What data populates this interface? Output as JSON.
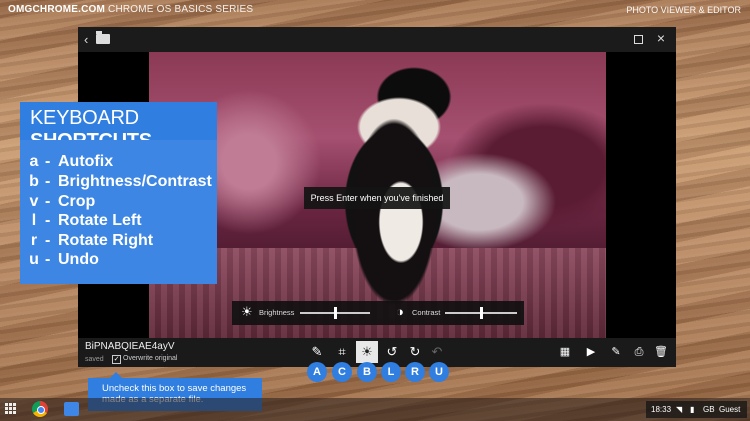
{
  "banner": {
    "brand": "OMGCHROME.COM",
    "series": "CHROME OS BASICS SERIES",
    "right_title": "PHOTO VIEWER & EDITOR"
  },
  "editor": {
    "enter_tooltip": "Press Enter when you've finished",
    "adjust": {
      "brightness_label": "Brightness",
      "contrast_label": "Contrast",
      "brightness_level": 0.5,
      "contrast_level": 0.5
    },
    "file": {
      "name": "BiPNABQIEAE4ayV",
      "status": "saved",
      "overwrite_label": "Overwrite original",
      "overwrite_checked": true
    },
    "tools": [
      {
        "icon": "autofix-icon",
        "glyph": "✎"
      },
      {
        "icon": "crop-icon",
        "glyph": "⌗"
      },
      {
        "icon": "brightness-icon",
        "glyph": "☀"
      },
      {
        "icon": "rotate-left-icon",
        "glyph": "↺"
      },
      {
        "icon": "rotate-right-icon",
        "glyph": "↻"
      },
      {
        "icon": "undo-icon",
        "glyph": "↶"
      }
    ],
    "right_tools": [
      {
        "icon": "mosaic-icon",
        "glyph": "▦"
      },
      {
        "icon": "slideshow-icon",
        "glyph": "▶"
      },
      {
        "icon": "edit-icon",
        "glyph": "✎"
      },
      {
        "icon": "print-icon",
        "glyph": "⎙"
      },
      {
        "icon": "delete-icon",
        "glyph": "🗑"
      }
    ]
  },
  "shortcuts": {
    "title_light": "KEYBOARD",
    "title_bold": "SHORTCUTS",
    "dash": "-",
    "items": [
      {
        "key": "a",
        "action": "Autofix"
      },
      {
        "key": "b",
        "action": "Brightness/Contrast"
      },
      {
        "key": "v",
        "action": "Crop"
      },
      {
        "key": "l",
        "action": "Rotate Left"
      },
      {
        "key": "r",
        "action": "Rotate Right"
      },
      {
        "key": "u",
        "action": "Undo"
      }
    ]
  },
  "tool_letters": [
    "A",
    "C",
    "B",
    "L",
    "R",
    "U"
  ],
  "callout": "Uncheck this box to save changes made as a separate file.",
  "shelf": {
    "time": "18:33",
    "keyboard": "GB",
    "user": "Guest"
  },
  "colors": {
    "accent": "#2f7ee0"
  }
}
